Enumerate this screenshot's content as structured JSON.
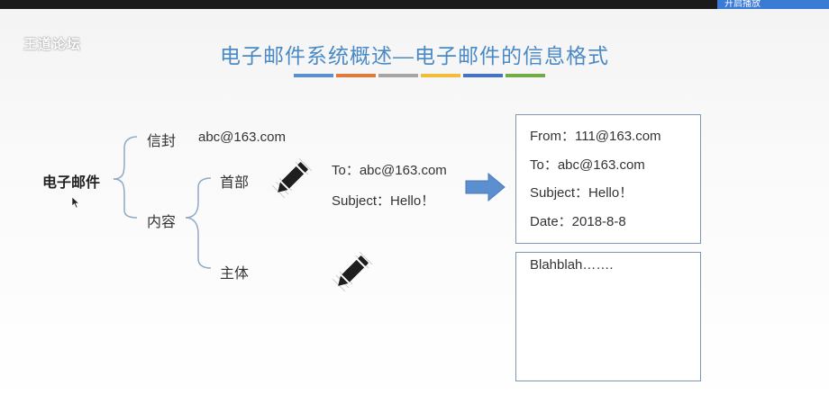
{
  "topbar": {
    "label": "开启播放"
  },
  "watermark": {
    "text": "王道论坛"
  },
  "slide": {
    "title": "电子邮件系统概述—电子邮件的信息格式",
    "color_bars": [
      "#5b8fd0",
      "#e07b39",
      "#a5a5a5",
      "#f1bd3b",
      "#4472c4",
      "#70ad47"
    ]
  },
  "tree": {
    "root": "电子邮件",
    "envelope": {
      "label": "信封",
      "value": "abc@163.com"
    },
    "content": {
      "label": "内容",
      "header": "首部",
      "body": "主体"
    }
  },
  "header_fields": {
    "to": "To：abc@163.com",
    "subject": "Subject：Hello！"
  },
  "result_header": {
    "from": "From：111@163.com",
    "to": "To：abc@163.com",
    "subject": "Subject：Hello！",
    "date": "Date：2018-8-8"
  },
  "result_body": {
    "text": "Blahblah……."
  },
  "icons": [
    "pencil-icon",
    "arrow-right-icon",
    "mouse-cursor-icon"
  ]
}
